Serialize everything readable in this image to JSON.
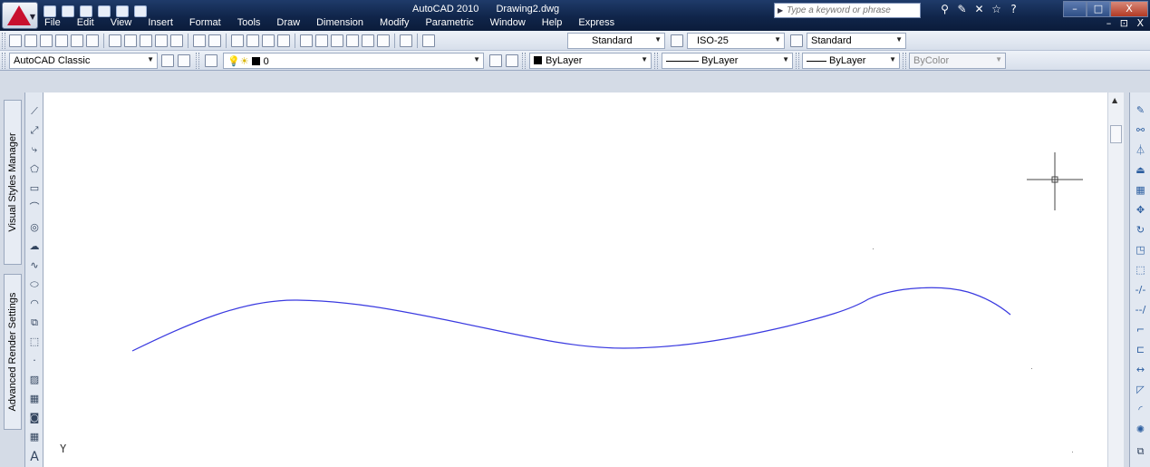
{
  "window": {
    "app_name": "AutoCAD 2010",
    "document": "Drawing2.dwg",
    "search_placeholder": "Type a keyword or phrase",
    "controls": [
      "–",
      "□",
      "X"
    ],
    "mdi_controls": "–  ⊡  X"
  },
  "menu": [
    "File",
    "Edit",
    "View",
    "Insert",
    "Format",
    "Tools",
    "Draw",
    "Dimension",
    "Modify",
    "Parametric",
    "Window",
    "Help",
    "Express"
  ],
  "toolbars": {
    "text_style": "Standard",
    "dim_style": "ISO-25",
    "table_style": "Standard",
    "workspace": "AutoCAD Classic",
    "layer": "0",
    "color": "ByLayer",
    "linetype": "ByLayer",
    "lineweight": "ByLayer",
    "plot_style": "ByColor"
  },
  "palettes": {
    "visual_styles": "Visual Styles Manager",
    "render_settings": "Advanced Render Settings"
  },
  "canvas": {
    "ucs_label": "Y",
    "curve_color": "#3a3ae0",
    "background": "#ffffff"
  },
  "icons": {
    "draw_toolbar": [
      "line-icon",
      "construction-line-icon",
      "polyline-icon",
      "polygon-icon",
      "rectangle-icon",
      "arc-icon",
      "circle-icon",
      "revision-cloud-icon",
      "spline-icon",
      "ellipse-icon",
      "ellipse-arc-icon",
      "insert-block-icon",
      "make-block-icon",
      "point-icon",
      "hatch-icon",
      "gradient-icon",
      "region-icon",
      "table-icon",
      "multiline-text-icon"
    ],
    "modify_toolbar": [
      "erase-icon",
      "copy-icon",
      "mirror-icon",
      "offset-icon",
      "array-icon",
      "move-icon",
      "rotate-icon",
      "scale-icon",
      "stretch-icon",
      "trim-icon",
      "extend-icon",
      "break-at-point-icon",
      "break-icon",
      "join-icon",
      "chamfer-icon",
      "fillet-icon",
      "explode-icon"
    ]
  }
}
